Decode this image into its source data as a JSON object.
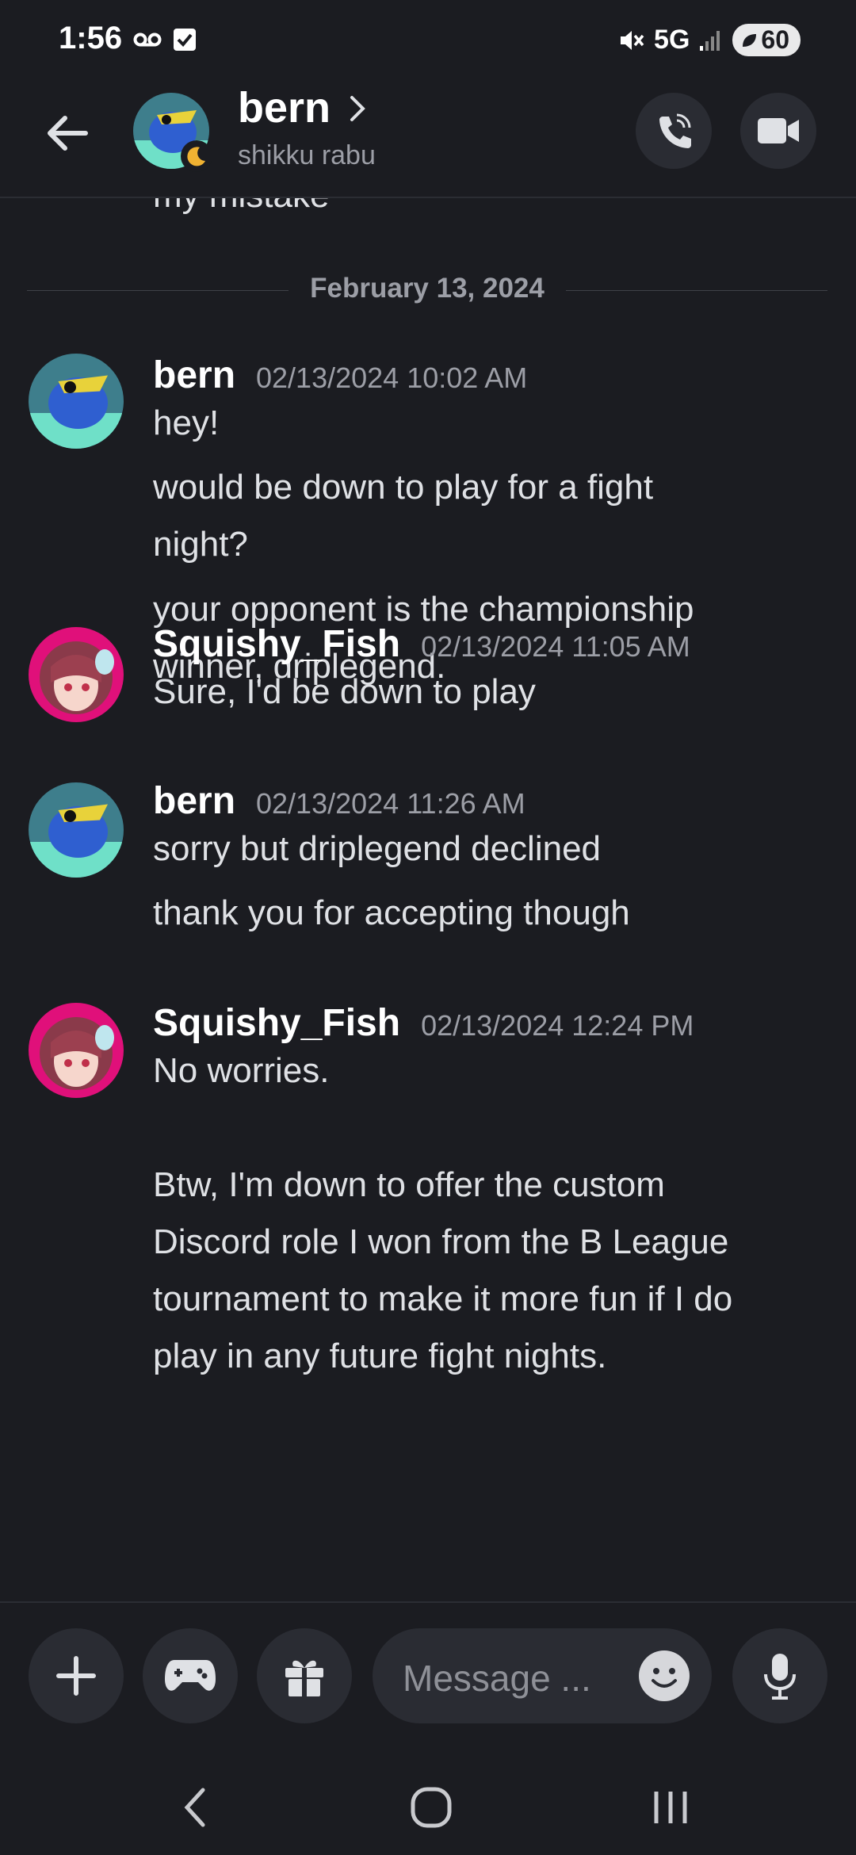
{
  "status_bar": {
    "time": "1:56",
    "network": "5G",
    "battery": "60"
  },
  "header": {
    "contact_name": "bern",
    "contact_subtitle": "shikku rabu"
  },
  "chat": {
    "partial_top_text": "my mistake",
    "date_divider": "February 13, 2024",
    "messages": [
      {
        "author": "bern",
        "timestamp": "02/13/2024 10:02 AM",
        "lines": [
          "hey!",
          "would be down to play for a fight",
          "night?",
          "your opponent is the championship",
          "winner, driplegend."
        ]
      },
      {
        "author": "Squishy_Fish",
        "timestamp": "02/13/2024 11:05 AM",
        "lines": [
          "Sure, I'd be down to play"
        ]
      },
      {
        "author": "bern",
        "timestamp": "02/13/2024 11:26 AM",
        "lines": [
          "sorry but driplegend declined",
          "thank you for accepting though"
        ]
      },
      {
        "author": "Squishy_Fish",
        "timestamp": "02/13/2024 12:24 PM",
        "lines": [
          "No worries.",
          "Btw, I'm down to offer the custom",
          "Discord role I won from the B League",
          "tournament to make it more fun if I do",
          "play in any future fight nights."
        ]
      }
    ]
  },
  "composer": {
    "placeholder": "Message ..."
  },
  "icons": {
    "back": "arrow-left-icon",
    "call": "phone-call-icon",
    "video": "video-camera-icon",
    "add": "plus-icon",
    "games": "gamepad-icon",
    "gift": "gift-icon",
    "emoji": "emoji-icon",
    "mic": "microphone-icon"
  },
  "colors": {
    "background": "#1b1c21",
    "surface": "#2a2c33",
    "text": "#dfe1e5",
    "muted": "#9c9ea6"
  }
}
